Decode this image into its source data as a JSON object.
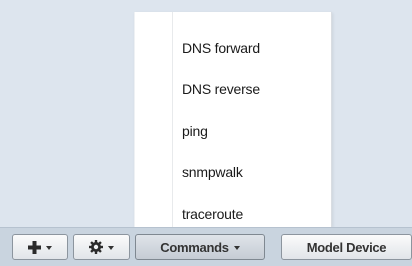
{
  "menu": {
    "items": [
      {
        "label": "DNS forward"
      },
      {
        "label": "DNS reverse"
      },
      {
        "label": "ping"
      },
      {
        "label": "snmpwalk"
      },
      {
        "label": "traceroute"
      }
    ]
  },
  "toolbar": {
    "add_icon": "plus-icon",
    "settings_icon": "gear-icon",
    "commands_label": "Commands",
    "model_device_label": "Model Device"
  }
}
